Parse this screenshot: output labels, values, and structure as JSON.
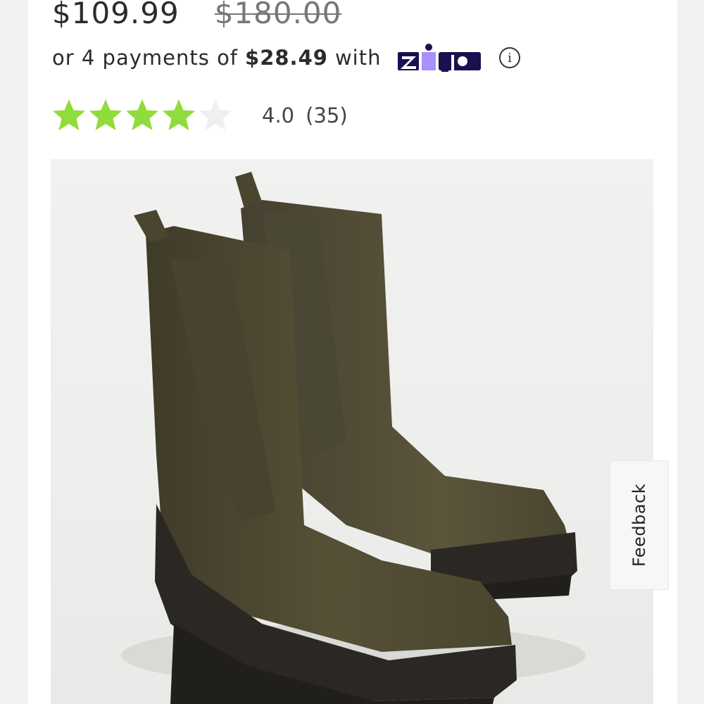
{
  "price": {
    "current": "$109.99",
    "original": "$180.00"
  },
  "installments": {
    "prefix": "or 4 payments of",
    "amount": "$28.49",
    "suffix": "with",
    "provider": "Zip",
    "info_icon": "info-icon"
  },
  "rating": {
    "stars_value": 4,
    "stars_max": 5,
    "value": "4.0",
    "count": "(35)"
  },
  "product_image": {
    "subject": "olive green leather chelsea boots"
  },
  "feedback": {
    "label": "Feedback"
  },
  "colors": {
    "star_filled": "#8fdc3a",
    "star_empty": "#efefef",
    "zip_navy": "#1a0f4f",
    "zip_purple": "#aa8fff",
    "boot_leather": "#4f4a33"
  }
}
